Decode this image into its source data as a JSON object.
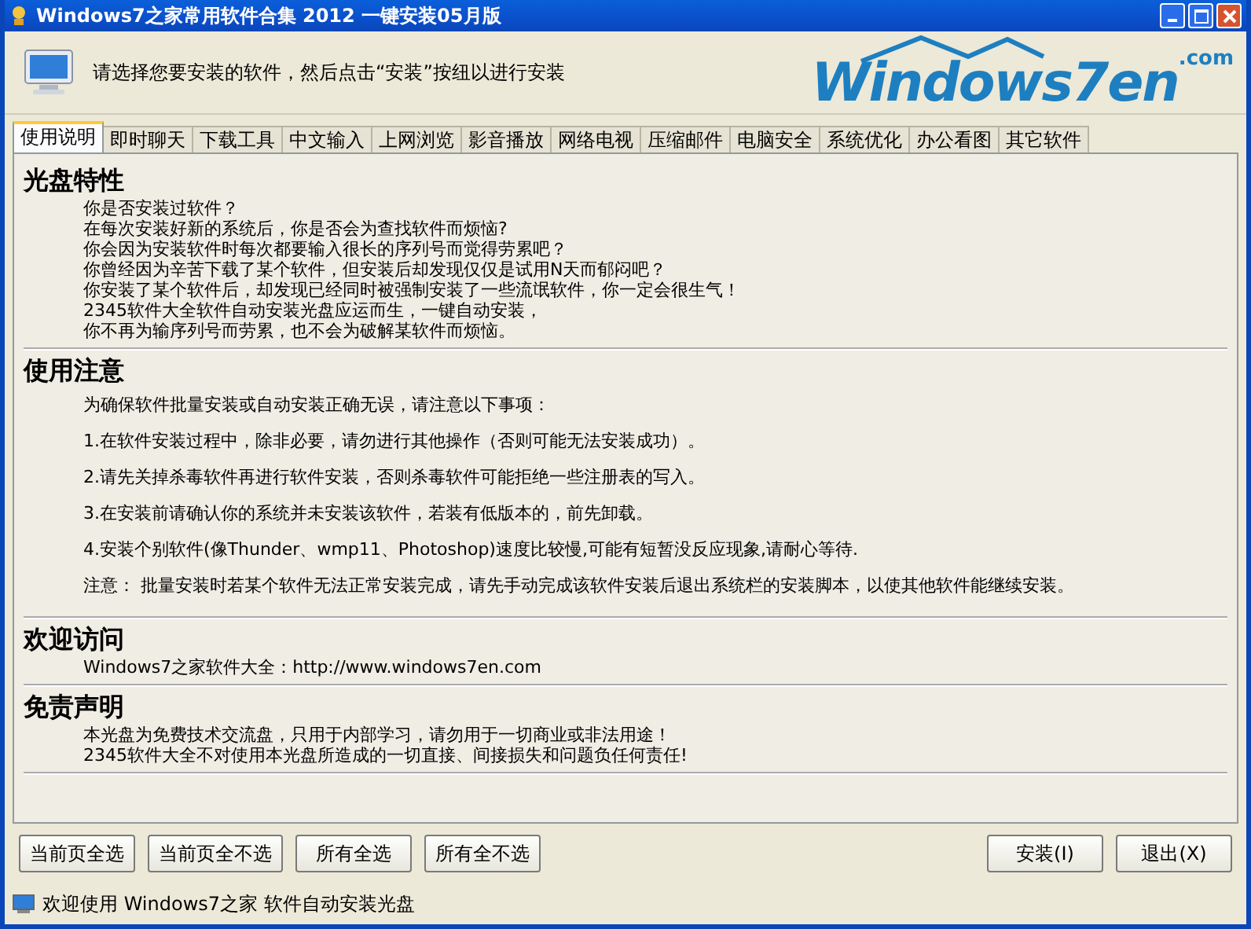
{
  "window": {
    "title": "Windows7之家常用软件合集 2012 一键安装05月版"
  },
  "header": {
    "message": "请选择您要安装的软件，然后点击“安装”按纽以进行安装",
    "logo_text": "Windows7en",
    "logo_suffix": ".com"
  },
  "tabs": [
    {
      "label": "使用说明",
      "selected": true
    },
    {
      "label": "即时聊天",
      "selected": false
    },
    {
      "label": "下载工具",
      "selected": false
    },
    {
      "label": "中文输入",
      "selected": false
    },
    {
      "label": "上网浏览",
      "selected": false
    },
    {
      "label": "影音播放",
      "selected": false
    },
    {
      "label": "网络电视",
      "selected": false
    },
    {
      "label": "压缩邮件",
      "selected": false
    },
    {
      "label": "电脑安全",
      "selected": false
    },
    {
      "label": "系统优化",
      "selected": false
    },
    {
      "label": "办公看图",
      "selected": false
    },
    {
      "label": "其它软件",
      "selected": false
    }
  ],
  "sections": [
    {
      "heading": "光盘特性",
      "kind": "tight",
      "lines": [
        "你是否安装过软件？",
        "在每次安装好新的系统后，你是否会为查找软件而烦恼?",
        "你会因为安装软件时每次都要输入很长的序列号而觉得劳累吧？",
        "你曾经因为辛苦下载了某个软件，但安装后却发现仅仅是试用N天而郁闷吧？",
        "你安装了某个软件后，却发现已经同时被强制安装了一些流氓软件，你一定会很生气！",
        "2345软件大全软件自动安装光盘应运而生，一键自动安装，",
        "你不再为输序列号而劳累，也不会为破解某软件而烦恼。"
      ]
    },
    {
      "heading": "使用注意",
      "kind": "spaced",
      "lines": [
        "为确保软件批量安装或自动安装正确无误，请注意以下事项：",
        "1.在软件安装过程中，除非必要，请勿进行其他操作（否则可能无法安装成功）。",
        "2.请先关掉杀毒软件再进行软件安装，否则杀毒软件可能拒绝一些注册表的写入。",
        "3.在安装前请确认你的系统并未安装该软件，若装有低版本的，前先卸载。",
        "4.安装个别软件(像Thunder、wmp11、Photoshop)速度比较慢,可能有短暂没反应现象,请耐心等待.",
        "注意：  批量安装时若某个软件无法正常安装完成，请先手动完成该软件安装后退出系统栏的安装脚本，以使其他软件能继续安装。"
      ]
    },
    {
      "heading": "欢迎访问",
      "kind": "tight",
      "lines": [
        "Windows7之家软件大全：http://www.windows7en.com"
      ]
    },
    {
      "heading": "免责声明",
      "kind": "tight",
      "lines": [
        "本光盘为免费技术交流盘，只用于内部学习，请勿用于一切商业或非法用途！",
        "2345软件大全不对使用本光盘所造成的一切直接、间接损失和问题负任何责任!"
      ]
    }
  ],
  "select_buttons": [
    "当前页全选",
    "当前页全不选",
    "所有全选",
    "所有全不选"
  ],
  "action_buttons": [
    "安装(I)",
    "退出(X)"
  ],
  "status_bar": {
    "text": "欢迎使用 Windows7之家 软件自动安装光盘"
  }
}
